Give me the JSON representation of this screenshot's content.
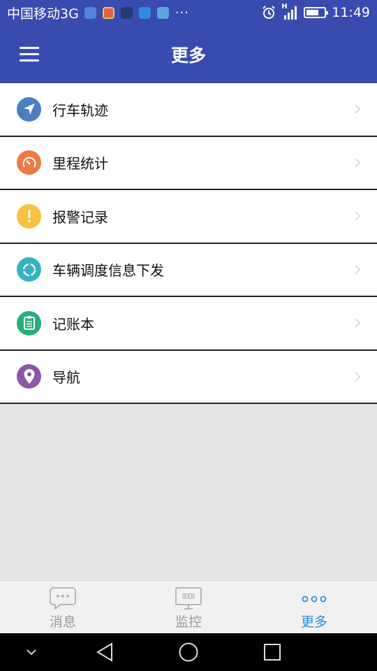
{
  "status_bar": {
    "carrier": "中国移动3G",
    "network": "H",
    "time": "11:49",
    "battery_level": 0.7,
    "icons": [
      "location-app-icon",
      "chrome-icon",
      "app-icon",
      "chat-icon",
      "weather-icon"
    ],
    "more": "···"
  },
  "app_bar": {
    "title": "更多",
    "menu_icon": "hamburger-menu-icon",
    "color": "#3a4bb0"
  },
  "menu": {
    "items": [
      {
        "label": "行车轨迹",
        "icon": "navigation-arrow-icon",
        "color": "#4a7fc1"
      },
      {
        "label": "里程统计",
        "icon": "speedometer-icon",
        "color": "#ee7a44"
      },
      {
        "label": "报警记录",
        "icon": "alert-icon",
        "color": "#f7c141"
      },
      {
        "label": "车辆调度信息下发",
        "icon": "sync-icon",
        "color": "#35b3c4"
      },
      {
        "label": "记账本",
        "icon": "clipboard-icon",
        "color": "#27ae7a"
      },
      {
        "label": "导航",
        "icon": "location-pin-icon",
        "color": "#8b58a8"
      }
    ]
  },
  "tab_bar": {
    "tabs": [
      {
        "label": "消息",
        "icon": "chat-bubble-icon",
        "active": false
      },
      {
        "label": "监控",
        "icon": "monitor-icon",
        "active": false
      },
      {
        "label": "更多",
        "icon": "more-dots-icon",
        "active": true
      }
    ],
    "active_color": "#2e8be0",
    "inactive_color": "#9a9a9a"
  },
  "nav_bar": {
    "buttons": [
      "collapse-icon",
      "back-icon",
      "home-icon",
      "recents-icon"
    ]
  }
}
